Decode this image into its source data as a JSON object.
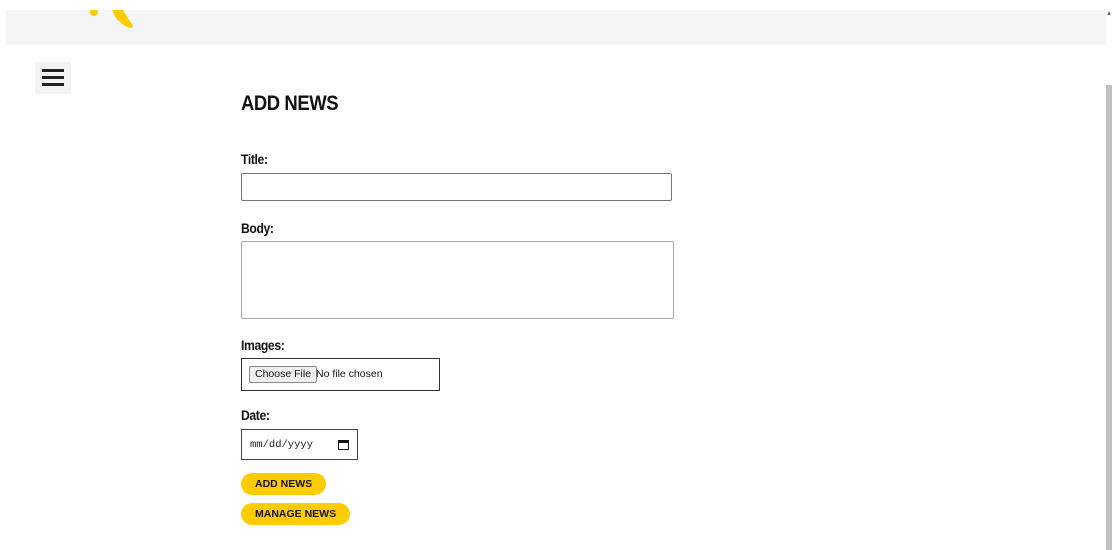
{
  "header": {
    "logo_icon": "logo-icon",
    "brand_color": "#ffcc00"
  },
  "nav": {
    "menu_icon": "hamburger-menu-icon"
  },
  "form": {
    "heading": "ADD NEWS",
    "title_label": "Title:",
    "title_value": "",
    "body_label": "Body:",
    "body_value": "",
    "images_label": "Images:",
    "file_button": "Choose File",
    "file_status": "No file chosen",
    "date_label": "Date:",
    "date_placeholder": "mm/dd/yyyy",
    "add_button": "ADD NEWS",
    "manage_button": "MANAGE NEWS"
  }
}
